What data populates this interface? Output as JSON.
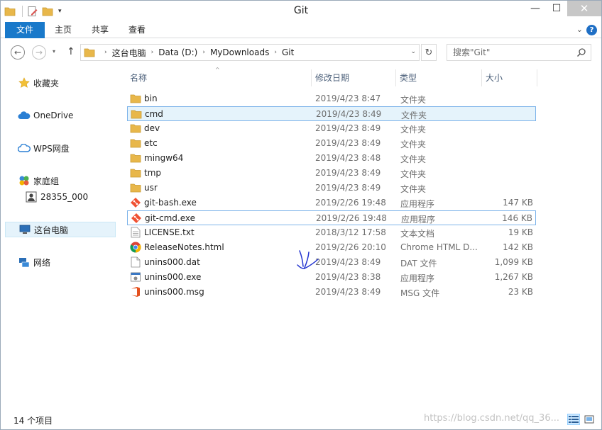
{
  "window": {
    "title": "Git"
  },
  "qat": {
    "icons": [
      "folder-icon",
      "properties-icon",
      "new-folder-icon"
    ],
    "dropdown": "▾"
  },
  "caption": {
    "minimize": "—",
    "maximize": "☐",
    "close": "✕"
  },
  "ribbon": {
    "tabs": [
      "文件",
      "主页",
      "共享",
      "查看"
    ],
    "expand": "⌄",
    "help": "?"
  },
  "nav": {
    "back": "←",
    "forward": "→",
    "recent": "▾",
    "up": "↑",
    "breadcrumb": [
      "这台电脑",
      "Data (D:)",
      "MyDownloads",
      "Git"
    ],
    "crumb_sep": "›",
    "address_dropdown": "⌄",
    "refresh": "↻",
    "search_placeholder": "搜索\"Git\""
  },
  "navpane": {
    "items": [
      {
        "label": "收藏夹",
        "icon": "star-icon"
      },
      {
        "label": "OneDrive",
        "icon": "cloud-icon"
      },
      {
        "label": "WPS网盘",
        "icon": "cloud-icon"
      },
      {
        "label": "家庭组",
        "icon": "homegroup-icon"
      },
      {
        "label": "28355_000",
        "icon": "user-icon"
      },
      {
        "label": "这台电脑",
        "icon": "computer-icon"
      },
      {
        "label": "网络",
        "icon": "network-icon"
      }
    ]
  },
  "columns": {
    "name": "名称",
    "date": "修改日期",
    "type": "类型",
    "size": "大小",
    "sort_caret": "^"
  },
  "files": [
    {
      "name": "bin",
      "date": "2019/4/23 8:47",
      "type": "文件夹",
      "size": "",
      "icon": "folder-icon"
    },
    {
      "name": "cmd",
      "date": "2019/4/23 8:49",
      "type": "文件夹",
      "size": "",
      "icon": "folder-icon"
    },
    {
      "name": "dev",
      "date": "2019/4/23 8:49",
      "type": "文件夹",
      "size": "",
      "icon": "folder-icon"
    },
    {
      "name": "etc",
      "date": "2019/4/23 8:49",
      "type": "文件夹",
      "size": "",
      "icon": "folder-icon"
    },
    {
      "name": "mingw64",
      "date": "2019/4/23 8:48",
      "type": "文件夹",
      "size": "",
      "icon": "folder-icon"
    },
    {
      "name": "tmp",
      "date": "2019/4/23 8:49",
      "type": "文件夹",
      "size": "",
      "icon": "folder-icon"
    },
    {
      "name": "usr",
      "date": "2019/4/23 8:49",
      "type": "文件夹",
      "size": "",
      "icon": "folder-icon"
    },
    {
      "name": "git-bash.exe",
      "date": "2019/2/26 19:48",
      "type": "应用程序",
      "size": "147 KB",
      "icon": "git-icon"
    },
    {
      "name": "git-cmd.exe",
      "date": "2019/2/26 19:48",
      "type": "应用程序",
      "size": "146 KB",
      "icon": "git-icon"
    },
    {
      "name": "LICENSE.txt",
      "date": "2018/3/12 17:58",
      "type": "文本文档",
      "size": "19 KB",
      "icon": "text-file-icon"
    },
    {
      "name": "ReleaseNotes.html",
      "date": "2019/2/26 20:10",
      "type": "Chrome HTML D...",
      "size": "142 KB",
      "icon": "chrome-icon"
    },
    {
      "name": "unins000.dat",
      "date": "2019/4/23 8:49",
      "type": "DAT 文件",
      "size": "1,099 KB",
      "icon": "blank-file-icon"
    },
    {
      "name": "unins000.exe",
      "date": "2019/4/23 8:38",
      "type": "应用程序",
      "size": "1,267 KB",
      "icon": "installer-icon"
    },
    {
      "name": "unins000.msg",
      "date": "2019/4/23 8:49",
      "type": "MSG 文件",
      "size": "23 KB",
      "icon": "office-icon"
    }
  ],
  "status": {
    "count": "14 个项目",
    "watermark": "https://blog.csdn.net/qq_36..."
  },
  "colors": {
    "accent": "#1979ca",
    "selection": "#e5f3fb",
    "selection_border": "#7eb4ea",
    "folder": "#e8b74a"
  }
}
